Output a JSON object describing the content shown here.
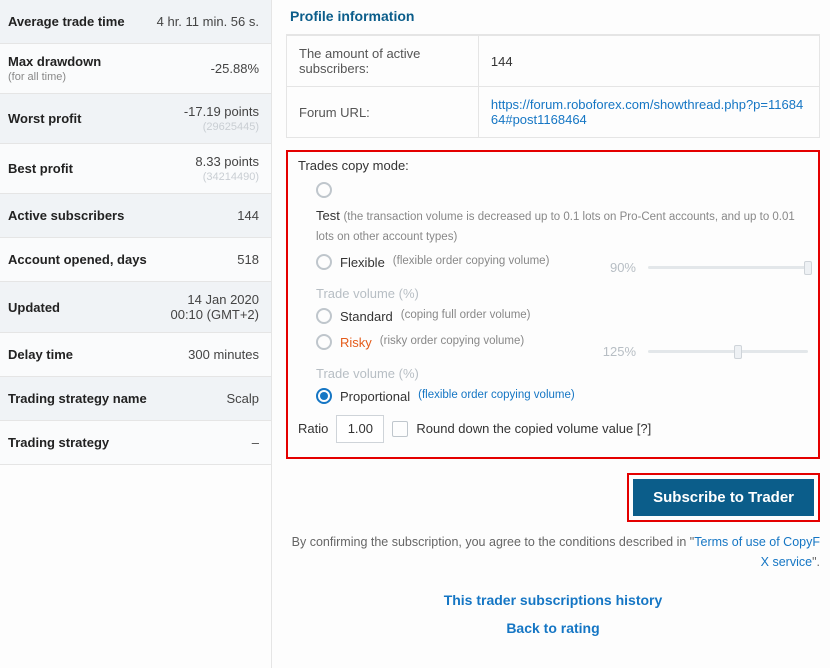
{
  "stats": {
    "avg_trade_time": {
      "label": "Average trade time",
      "value": "4 hr. 11 min. 56 s."
    },
    "max_drawdown": {
      "label": "Max drawdown",
      "sub": "(for all time)",
      "value": "-25.88%"
    },
    "worst_profit": {
      "label": "Worst profit",
      "value": "-17.19 points",
      "value_sub": "(29625445)"
    },
    "best_profit": {
      "label": "Best profit",
      "value": "8.33 points",
      "value_sub": "(34214490)"
    },
    "active_subs": {
      "label": "Active subscribers",
      "value": "144"
    },
    "account_opened": {
      "label": "Account opened, days",
      "value": "518"
    },
    "updated": {
      "label": "Updated",
      "value": "14 Jan 2020",
      "value_sub2": "00:10 (GMT+2)"
    },
    "delay_time": {
      "label": "Delay time",
      "value": "300 minutes"
    },
    "strategy_name": {
      "label": "Trading strategy name",
      "value": "Scalp"
    },
    "strategy": {
      "label": "Trading strategy",
      "value": "–"
    }
  },
  "profile": {
    "title": "Profile information",
    "subs_label": "The amount of active subscribers:",
    "subs_value": "144",
    "forum_label": "Forum URL:",
    "forum_url": "https://forum.roboforex.com/showthread.php?p=1168464#post1168464"
  },
  "copy_mode": {
    "title": "Trades copy mode:",
    "test": {
      "label": "Test",
      "note": "(the transaction volume is decreased up to 0.1 lots on Pro-Cent accounts, and up to 0.01 lots on other account types)"
    },
    "flexible": {
      "label": "Flexible",
      "note": "(flexible order copying volume)"
    },
    "vol1_label": "Trade volume (%)",
    "vol1_pct": "90%",
    "standard": {
      "label": "Standard",
      "note": "(coping full order volume)"
    },
    "risky": {
      "label": "Risky",
      "note": "(risky order copying volume)"
    },
    "vol2_label": "Trade volume (%)",
    "vol2_pct": "125%",
    "proportional": {
      "label": "Proportional",
      "note": "(flexible order copying volume)"
    },
    "ratio_label": "Ratio",
    "ratio_value": "1.00",
    "round_down": "Round down the copied volume value [?]"
  },
  "subscribe": {
    "button": "Subscribe to Trader",
    "confirm_pre": "By confirming the subscription, you agree to the conditions described in \"",
    "confirm_link": "Terms of use of CopyFX service",
    "confirm_post": "\"."
  },
  "links": {
    "history": "This trader subscriptions history",
    "back": "Back to rating"
  }
}
